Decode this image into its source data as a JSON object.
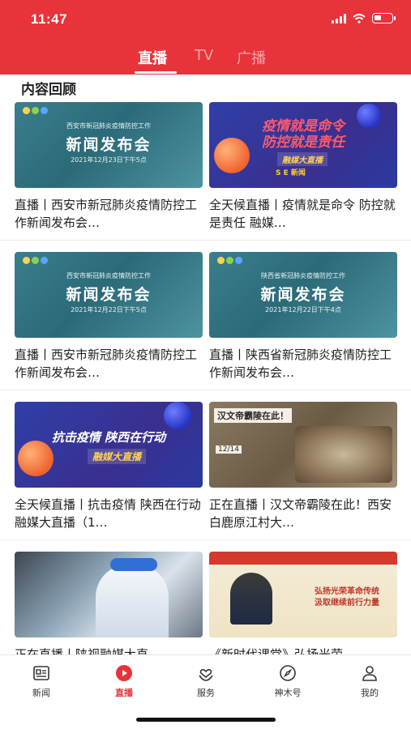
{
  "status_bar": {
    "time": "11:47"
  },
  "header": {
    "tabs": [
      {
        "label": "直播",
        "active": true
      },
      {
        "label": "TV",
        "active": false
      },
      {
        "label": "广播",
        "active": false
      }
    ],
    "background_color": "#e8333a"
  },
  "section": {
    "title": "内容回顾"
  },
  "cards": [
    {
      "title": "直播丨西安市新冠肺炎疫情防控工作新闻发布会…",
      "thumb": {
        "sub": "西安市新冠肺炎疫情防控工作",
        "main": "新闻发布会",
        "date": "2021年12月23日下午5点"
      }
    },
    {
      "title": "全天候直播丨疫情就是命令 防控就是责任 融媒…",
      "thumb": {
        "heading_line1": "疫情就是命令",
        "heading_line2": "防控就是责任",
        "tag": "融媒大直播",
        "brand": "S E 新闻"
      }
    },
    {
      "title": "直播丨西安市新冠肺炎疫情防控工作新闻发布会…",
      "thumb": {
        "sub": "西安市新冠肺炎疫情防控工作",
        "main": "新闻发布会",
        "date": "2021年12月22日下午5点"
      }
    },
    {
      "title": "直播丨陕西省新冠肺炎疫情防控工作新闻发布会…",
      "thumb": {
        "sub": "陕西省新冠肺炎疫情防控工作",
        "main": "新闻发布会",
        "date": "2021年12月22日下午4点"
      }
    },
    {
      "title": "全天候直播丨抗击疫情 陕西在行动融媒大直播（1…",
      "thumb": {
        "heading_line1": "抗击疫情 陕西在行动",
        "tag": "融媒大直播"
      }
    },
    {
      "title": "正在直播丨汉文帝霸陵在此！西安白鹿原江村大…",
      "thumb": {
        "heading": "汉文帝霸陵在此！",
        "date": "12/14"
      }
    },
    {
      "title": "正在直播丨陕视融媒大直",
      "thumb": {}
    },
    {
      "title": "《新时代课堂》弘扬光荣",
      "thumb": {
        "line1": "弘扬光荣革命传统",
        "line2": "汲取继续前行力量"
      }
    }
  ],
  "tabbar": {
    "items": [
      {
        "label": "新闻",
        "icon": "news-icon",
        "active": false
      },
      {
        "label": "直播",
        "icon": "play-icon",
        "active": true
      },
      {
        "label": "服务",
        "icon": "heart-hands-icon",
        "active": false
      },
      {
        "label": "神木号",
        "icon": "compass-icon",
        "active": false
      },
      {
        "label": "我的",
        "icon": "user-icon",
        "active": false
      }
    ],
    "active_color": "#e8333a"
  }
}
